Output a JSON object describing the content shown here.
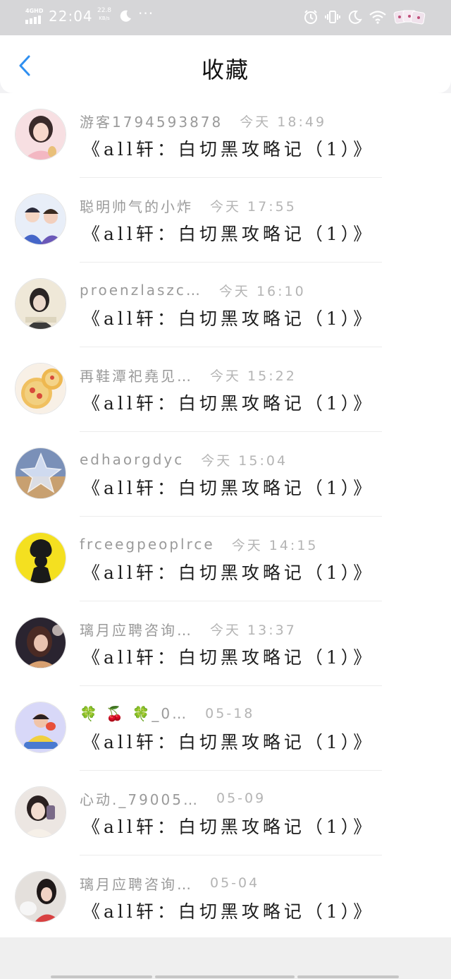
{
  "status_bar": {
    "network": "4GHD",
    "time": "22:04",
    "speed_value": "22.8",
    "speed_unit": "KB/s",
    "dots": "···"
  },
  "header": {
    "title": "收藏",
    "back_icon": "chevron-left-icon"
  },
  "colors": {
    "accent": "#2f8ff0",
    "username": "#9a9a9a",
    "time": "#b4b4b4",
    "content": "#1e1e1e"
  },
  "items": [
    {
      "user": "游客1794593878",
      "time": "今天 18:49",
      "content": "《all轩：白切黑攻略记（1）》"
    },
    {
      "user": "聪明帅气的小炸",
      "time": "今天 17:55",
      "content": "《all轩：白切黑攻略记（1）》"
    },
    {
      "user": "proenzlaszc…",
      "time": "今天 16:10",
      "content": "《all轩：白切黑攻略记（1）》"
    },
    {
      "user": "再鞋潭祀堯见…",
      "time": "今天 15:22",
      "content": "《all轩：白切黑攻略记（1）》"
    },
    {
      "user": "edhaorgdyc",
      "time": "今天 15:04",
      "content": "《all轩：白切黑攻略记（1）》"
    },
    {
      "user": "frceegpeoplrce",
      "time": "今天 14:15",
      "content": "《all轩：白切黑攻略记（1）》"
    },
    {
      "user": "璃月应聘咨询…",
      "time": "今天 13:37",
      "content": "《all轩：白切黑攻略记（1）》"
    },
    {
      "user": "🍀 🍒 🍀_0…",
      "time": "05-18",
      "content": "《all轩：白切黑攻略记（1）》"
    },
    {
      "user": "心动._79005…",
      "time": "05-09",
      "content": "《all轩：白切黑攻略记（1）》"
    },
    {
      "user": "璃月应聘咨询…",
      "time": "05-04",
      "content": "《all轩：白切黑攻略记（1）》"
    }
  ]
}
